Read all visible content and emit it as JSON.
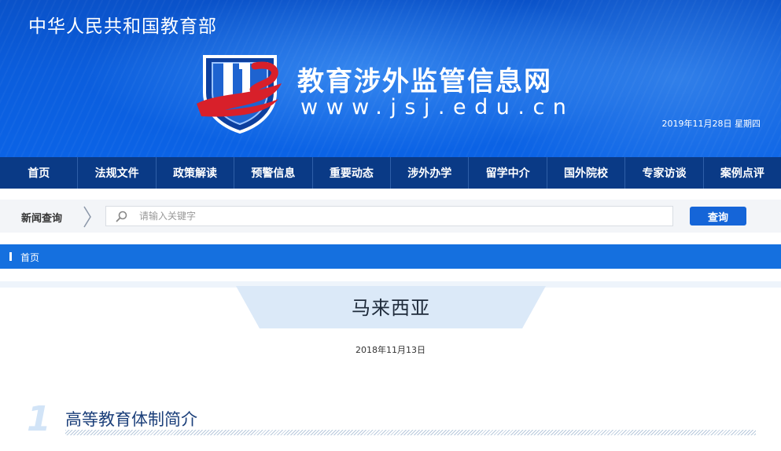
{
  "header": {
    "ministry": "中华人民共和国教育部",
    "site_name": "教育涉外监管信息网",
    "site_url": "www.jsj.edu.cn",
    "date": "2019年11月28日 星期四"
  },
  "nav": {
    "items": [
      {
        "label": "首页"
      },
      {
        "label": "法规文件"
      },
      {
        "label": "政策解读"
      },
      {
        "label": "预警信息"
      },
      {
        "label": "重要动态"
      },
      {
        "label": "涉外办学"
      },
      {
        "label": "留学中介"
      },
      {
        "label": "国外院校"
      },
      {
        "label": "专家访谈"
      },
      {
        "label": "案例点评"
      }
    ]
  },
  "search": {
    "label": "新闻查询",
    "placeholder": "请输入关键字",
    "value": "",
    "button_label": "查询"
  },
  "breadcrumb": {
    "home": "首页"
  },
  "article": {
    "title": "马来西亚",
    "date": "2018年11月13日",
    "section_number": "1",
    "section_title": "高等教育体制简介"
  },
  "icons": {
    "logo": "jsj-shield-logo-icon",
    "search": "search-icon",
    "separator": "chevron-right-icon"
  },
  "colors": {
    "header_blue": "#0b5ddc",
    "nav_dark": "#0a3a86",
    "accent_blue": "#1570df",
    "logo_red": "#d8202a"
  }
}
